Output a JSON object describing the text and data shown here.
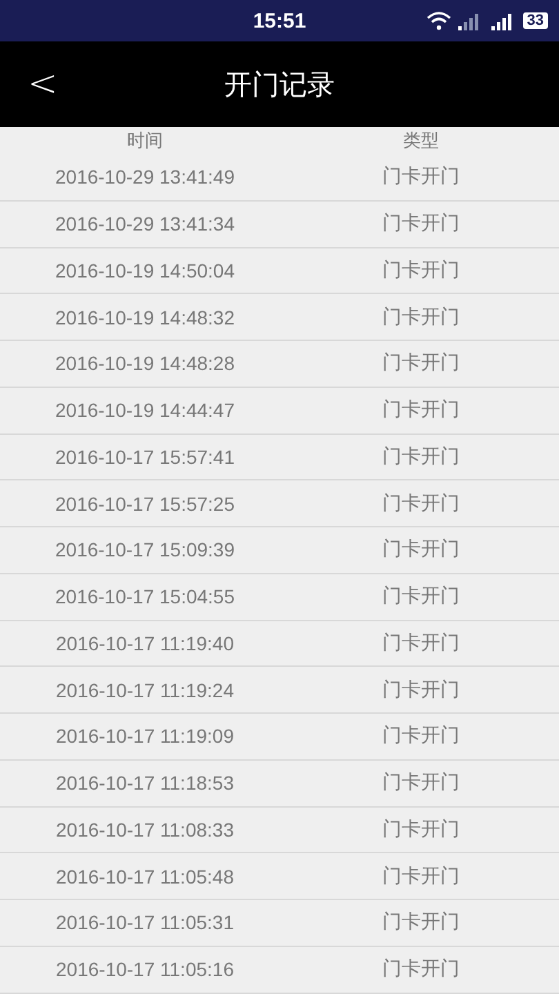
{
  "status_bar": {
    "time": "15:51",
    "battery": "33"
  },
  "header": {
    "back": "<",
    "title": "开门记录"
  },
  "table": {
    "columns": [
      "时间",
      "类型"
    ],
    "rows": [
      [
        "2016-10-29 13:41:49",
        "门卡开门"
      ],
      [
        "2016-10-29 13:41:34",
        "门卡开门"
      ],
      [
        "2016-10-19 14:50:04",
        "门卡开门"
      ],
      [
        "2016-10-19 14:48:32",
        "门卡开门"
      ],
      [
        "2016-10-19 14:48:28",
        "门卡开门"
      ],
      [
        "2016-10-19 14:44:47",
        "门卡开门"
      ],
      [
        "2016-10-17 15:57:41",
        "门卡开门"
      ],
      [
        "2016-10-17 15:57:25",
        "门卡开门"
      ],
      [
        "2016-10-17 15:09:39",
        "门卡开门"
      ],
      [
        "2016-10-17 15:04:55",
        "门卡开门"
      ],
      [
        "2016-10-17 11:19:40",
        "门卡开门"
      ],
      [
        "2016-10-17 11:19:24",
        "门卡开门"
      ],
      [
        "2016-10-17 11:19:09",
        "门卡开门"
      ],
      [
        "2016-10-17 11:18:53",
        "门卡开门"
      ],
      [
        "2016-10-17 11:08:33",
        "门卡开门"
      ],
      [
        "2016-10-17 11:05:48",
        "门卡开门"
      ],
      [
        "2016-10-17 11:05:31",
        "门卡开门"
      ],
      [
        "2016-10-17 11:05:16",
        "门卡开门"
      ]
    ]
  }
}
